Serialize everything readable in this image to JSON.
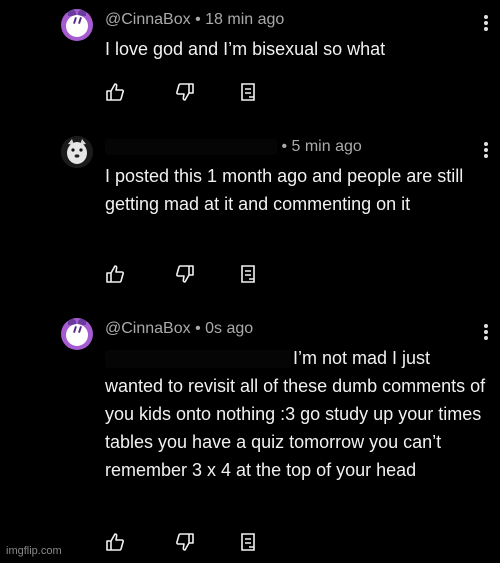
{
  "comments": [
    {
      "author": "@CinnaBox",
      "time": "• 18 min ago",
      "text": "I love god and I’m bisexual so what",
      "avatar": "cinnabox-avatar",
      "redacted_author": false
    },
    {
      "author": "",
      "time": "• 5 min ago",
      "text": "I posted this 1 month ago and people are still getting mad at it and commenting on it",
      "avatar": "dog-avatar",
      "redacted_author": true
    },
    {
      "author": "@CinnaBox",
      "time": "• 0s ago",
      "text": "I’m not mad I just wanted to revisit all of these dumb comments of you kids onto nothing :3 go study up your times tables you have a quiz tomorrow you can’t remember 3 x 4 at the top of your head",
      "avatar": "cinnabox-avatar",
      "redacted_author": false,
      "redacted_mention": true
    }
  ],
  "icons": {
    "like": "thumbs-up-icon",
    "dislike": "thumbs-down-icon",
    "reply": "reply-icon",
    "more": "more-vertical-icon"
  },
  "colors": {
    "background": "#000000",
    "text": "#f1f1f1",
    "meta": "#aaaaaa",
    "avatar_purple": "#a65bd1"
  },
  "watermark": "imgflip.com"
}
